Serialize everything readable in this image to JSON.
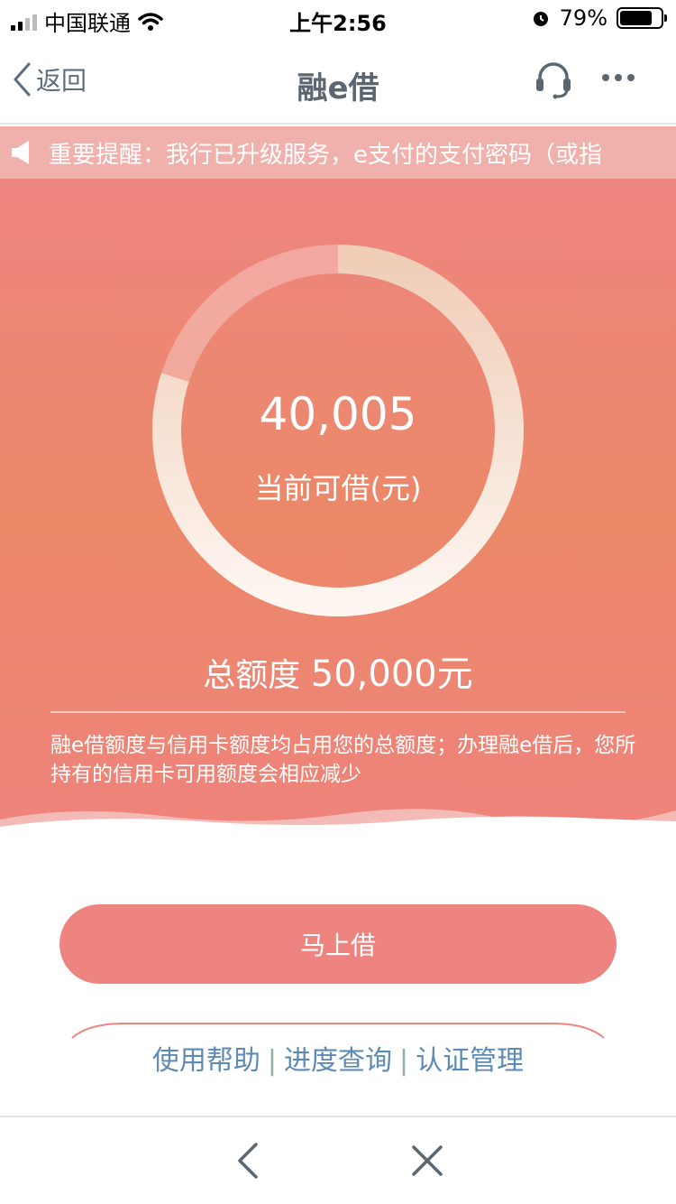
{
  "status_bar": {
    "carrier": "中国联通",
    "time": "上午2:56",
    "battery_percent": "79%",
    "battery_level": 0.79
  },
  "nav": {
    "back_label": "返回",
    "title": "融e借",
    "icons": [
      "chevron-left-icon",
      "headset-icon",
      "more-icon"
    ]
  },
  "notice": {
    "text": "重要提醒：我行已升级服务，e支付的支付密码（或指",
    "icon": "speaker-icon"
  },
  "loan": {
    "available_amount": "40,005",
    "available_label": "当前可借(元)",
    "total_label": "总额度",
    "total_amount": "50,000元",
    "available_fraction": 0.8001,
    "description": "融e借额度与信用卡额度均占用您的总额度；办理融e借后，您所持有的信用卡可用额度会相应减少"
  },
  "actions": {
    "borrow_label": "马上借",
    "help": "使用帮助",
    "separator": "|",
    "progress": "进度查询",
    "auth": "认证管理"
  },
  "colors": {
    "accent": "#ee8480",
    "link": "#5d8ab5",
    "nav_title": "#5b6670"
  }
}
